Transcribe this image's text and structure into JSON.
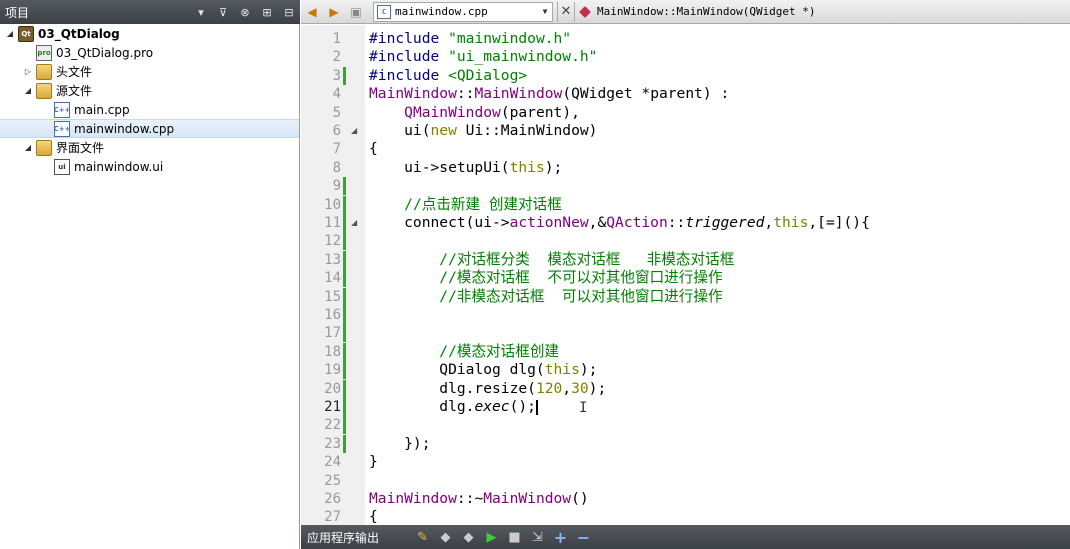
{
  "left_panel": {
    "title": "项目",
    "toolbar_icons": [
      "filter-icon",
      "link-icon",
      "split-icon",
      "close-panel-icon"
    ],
    "tree": [
      {
        "label": "03_QtDialog",
        "level": 0,
        "expanded": true,
        "icon": "project-icon",
        "bold": true
      },
      {
        "label": "03_QtDialog.pro",
        "level": 1,
        "icon": "pro-file-icon"
      },
      {
        "label": "头文件",
        "level": 1,
        "expanded": false,
        "icon": "folder-icon"
      },
      {
        "label": "源文件",
        "level": 1,
        "expanded": true,
        "icon": "folder-icon"
      },
      {
        "label": "main.cpp",
        "level": 2,
        "icon": "cpp-file-icon"
      },
      {
        "label": "mainwindow.cpp",
        "level": 2,
        "icon": "cpp-file-icon",
        "selected": true
      },
      {
        "label": "界面文件",
        "level": 1,
        "expanded": true,
        "icon": "folder-icon"
      },
      {
        "label": "mainwindow.ui",
        "level": 2,
        "icon": "ui-file-icon"
      }
    ]
  },
  "editor_header": {
    "current_file": "mainwindow.cpp",
    "current_symbol": "MainWindow::MainWindow(QWidget *)"
  },
  "editor": {
    "current_line": 21,
    "lines": [
      {
        "n": "1",
        "text": "#include \"mainwindow.h\""
      },
      {
        "n": "2",
        "text": "#include \"ui_mainwindow.h\""
      },
      {
        "n": "3",
        "text": "#include <QDialog>"
      },
      {
        "n": "4",
        "text": "MainWindow::MainWindow(QWidget *parent) :"
      },
      {
        "n": "5",
        "text": "    QMainWindow(parent),"
      },
      {
        "n": "6",
        "text": "    ui(new Ui::MainWindow)"
      },
      {
        "n": "7",
        "text": "{"
      },
      {
        "n": "8",
        "text": "    ui->setupUi(this);"
      },
      {
        "n": "9",
        "text": ""
      },
      {
        "n": "10",
        "text": "    //点击新建 创建对话框"
      },
      {
        "n": "11",
        "text": "    connect(ui->actionNew,&QAction::triggered,this,[=](){"
      },
      {
        "n": "12",
        "text": ""
      },
      {
        "n": "13",
        "text": "        //对话框分类  模态对话框   非模态对话框"
      },
      {
        "n": "14",
        "text": "        //模态对话框  不可以对其他窗口进行操作"
      },
      {
        "n": "15",
        "text": "        //非模态对话框  可以对其他窗口进行操作"
      },
      {
        "n": "16",
        "text": ""
      },
      {
        "n": "17",
        "text": ""
      },
      {
        "n": "18",
        "text": "        //模态对话框创建"
      },
      {
        "n": "19",
        "text": "        QDialog dlg(this);"
      },
      {
        "n": "20",
        "text": "        dlg.resize(120,30);"
      },
      {
        "n": "21",
        "text": "        dlg.exec();"
      },
      {
        "n": "22",
        "text": ""
      },
      {
        "n": "23",
        "text": "    });"
      },
      {
        "n": "24",
        "text": "}"
      },
      {
        "n": "25",
        "text": ""
      },
      {
        "n": "26",
        "text": "MainWindow::~MainWindow()"
      },
      {
        "n": "27",
        "text": "{"
      }
    ]
  },
  "bottom_bar": {
    "title": "应用程序输出"
  },
  "colors": {
    "keyword": "#808000",
    "string": "#008000",
    "class": "#800080",
    "comment": "#008000",
    "modified_bar": "#3aa23a",
    "panel_dark": "#454a50"
  }
}
